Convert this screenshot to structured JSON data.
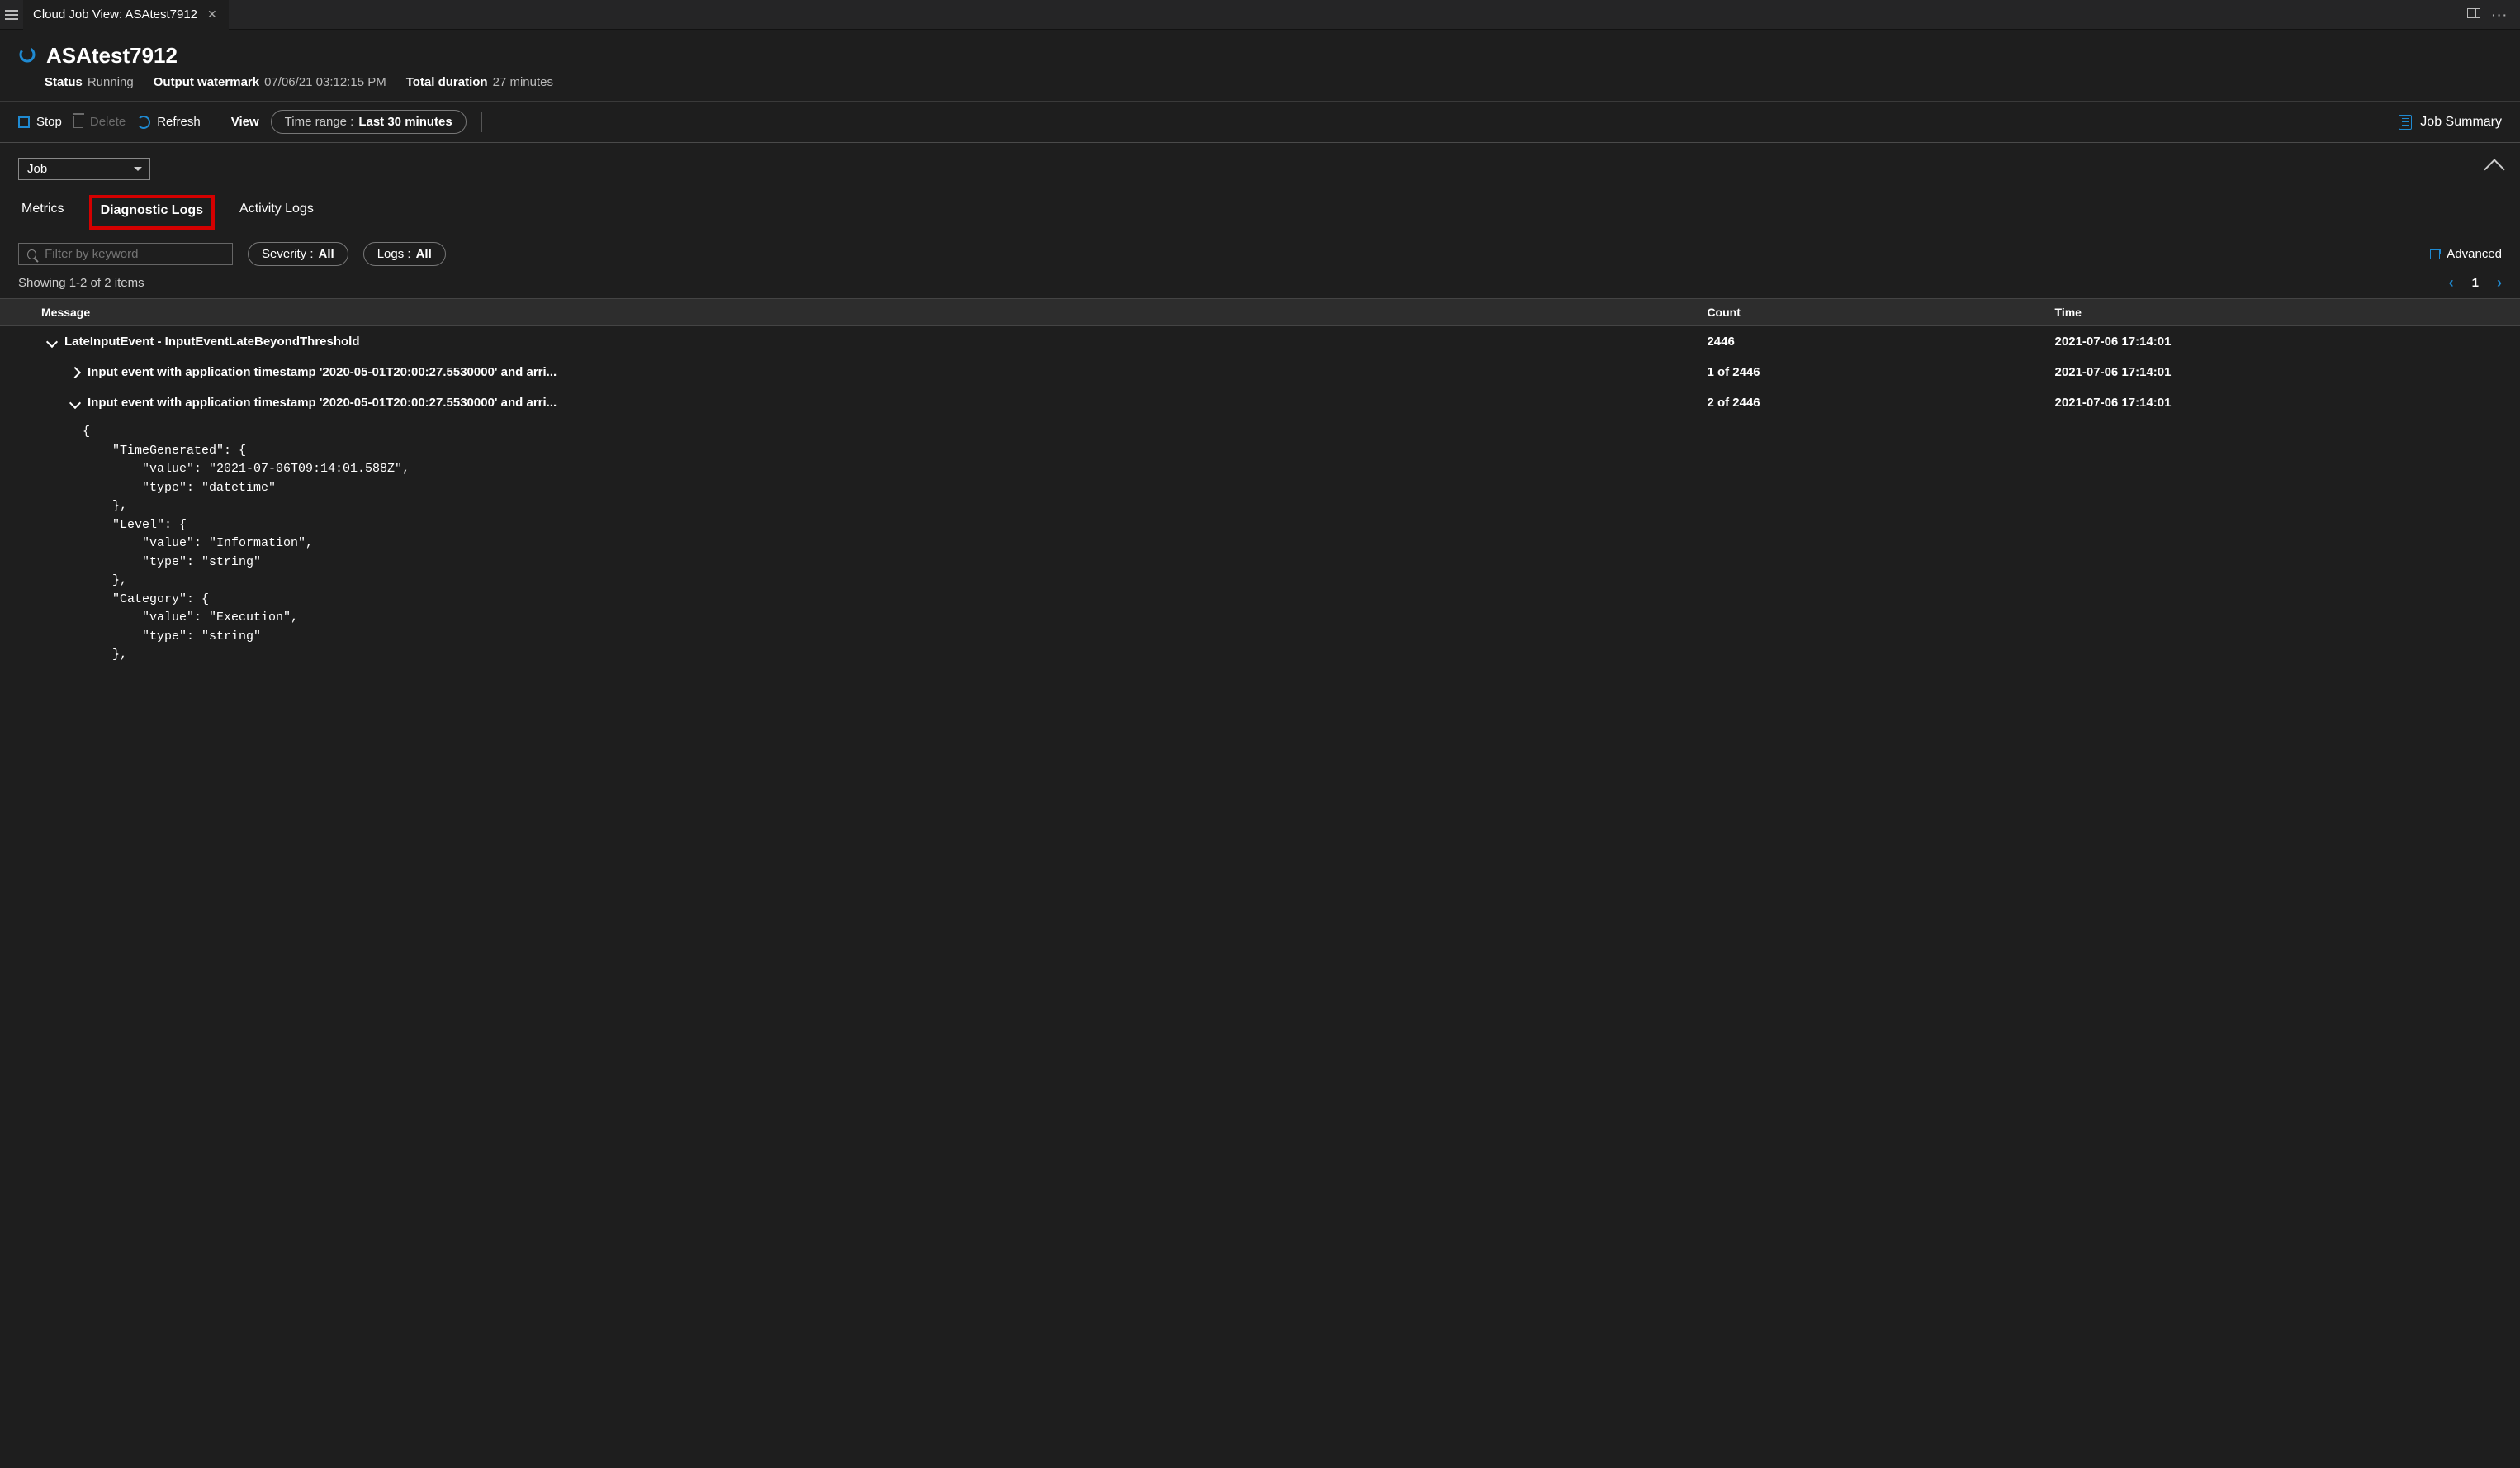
{
  "tabbar": {
    "tab_title": "Cloud Job View: ASAtest7912"
  },
  "header": {
    "title": "ASAtest7912",
    "status_label": "Status",
    "status_value": "Running",
    "watermark_label": "Output watermark",
    "watermark_value": "07/06/21 03:12:15 PM",
    "duration_label": "Total duration",
    "duration_value": "27 minutes"
  },
  "toolbar": {
    "stop": "Stop",
    "delete": "Delete",
    "refresh": "Refresh",
    "view": "View",
    "timerange_label": "Time range :",
    "timerange_value": "Last 30 minutes",
    "summary": "Job Summary"
  },
  "section": {
    "dropdown": "Job"
  },
  "tabs": {
    "metrics": "Metrics",
    "diagnostic": "Diagnostic Logs",
    "activity": "Activity Logs"
  },
  "filters": {
    "placeholder": "Filter by keyword",
    "severity_label": "Severity :",
    "severity_value": "All",
    "logs_label": "Logs :",
    "logs_value": "All",
    "advanced": "Advanced"
  },
  "pager": {
    "showing": "Showing 1-2 of 2 items",
    "page": "1"
  },
  "grid": {
    "col_message": "Message",
    "col_count": "Count",
    "col_time": "Time",
    "rows": [
      {
        "expand": "down",
        "indent": 1,
        "msg": "LateInputEvent - InputEventLateBeyondThreshold",
        "count": "2446",
        "time": "2021-07-06 17:14:01"
      },
      {
        "expand": "right",
        "indent": 2,
        "msg": "Input event with application timestamp '2020-05-01T20:00:27.5530000' and arri...",
        "count": "1 of 2446",
        "time": "2021-07-06 17:14:01"
      },
      {
        "expand": "down",
        "indent": 2,
        "msg": "Input event with application timestamp '2020-05-01T20:00:27.5530000' and arri...",
        "count": "2 of 2446",
        "time": "2021-07-06 17:14:01"
      }
    ]
  },
  "json_detail": "{\n    \"TimeGenerated\": {\n        \"value\": \"2021-07-06T09:14:01.588Z\",\n        \"type\": \"datetime\"\n    },\n    \"Level\": {\n        \"value\": \"Information\",\n        \"type\": \"string\"\n    },\n    \"Category\": {\n        \"value\": \"Execution\",\n        \"type\": \"string\"\n    },"
}
